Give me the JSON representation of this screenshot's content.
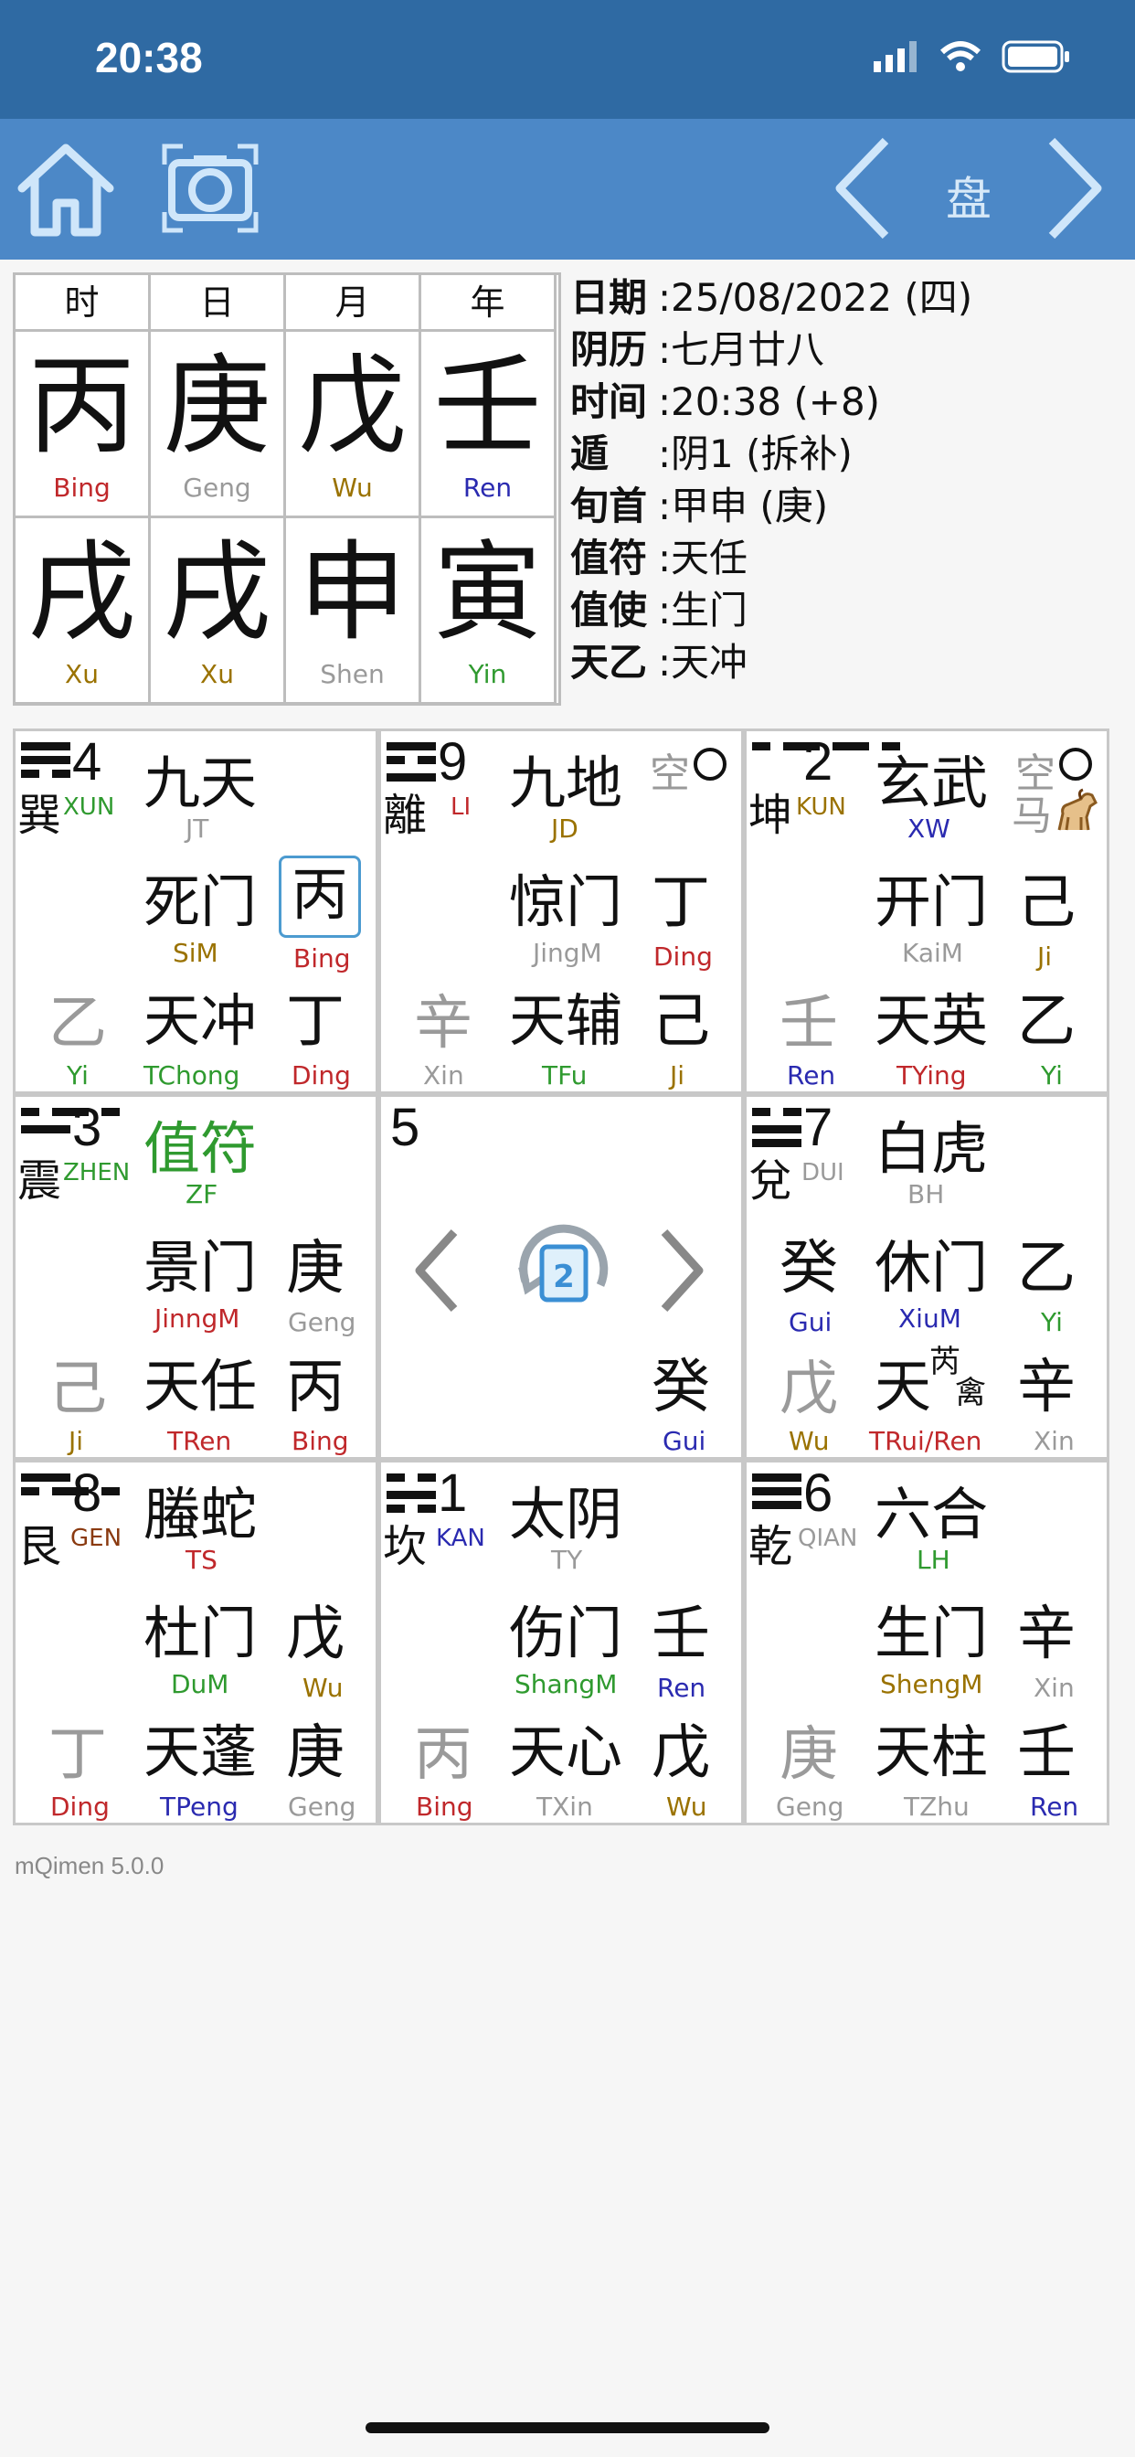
{
  "status_bar": {
    "time": "20:38"
  },
  "toolbar": {
    "center_label": "盘"
  },
  "pillars": [
    {
      "head": "时",
      "stem": "丙",
      "stem_rom": "Bing",
      "stem_color": "#c0282b",
      "branch": "戌",
      "branch_rom": "Xu",
      "branch_color": "#9a7200"
    },
    {
      "head": "日",
      "stem": "庚",
      "stem_rom": "Geng",
      "stem_color": "#9a9a9a",
      "branch": "戌",
      "branch_rom": "Xu",
      "branch_color": "#9a7200"
    },
    {
      "head": "月",
      "stem": "戊",
      "stem_rom": "Wu",
      "stem_color": "#9a7200",
      "branch": "申",
      "branch_rom": "Shen",
      "branch_color": "#9a9a9a"
    },
    {
      "head": "年",
      "stem": "壬",
      "stem_rom": "Ren",
      "stem_color": "#2a2ab0",
      "branch": "寅",
      "branch_rom": "Yin",
      "branch_color": "#2f9a2f"
    }
  ],
  "info": [
    {
      "label": "日期",
      "value": "25/08/2022 (四)"
    },
    {
      "label": "阴历",
      "value": "七月廿八"
    },
    {
      "label": "时间",
      "value": "20:38 (+8)"
    },
    {
      "label": "遁",
      "value": "阴1 (拆补)"
    },
    {
      "label": "旬首",
      "value": "甲申 (庚)"
    },
    {
      "label": "值符",
      "value": "天任"
    },
    {
      "label": "值使",
      "value": "生门"
    },
    {
      "label": "天乙",
      "value": "天冲"
    }
  ],
  "palaces": {
    "xun": {
      "num": "4",
      "tri": "巽",
      "tri_rom": "XUN",
      "deity": "九天",
      "deity_abbr": "JT",
      "door": "死门",
      "door_abbr": "SiM",
      "heaven_stem_upper": "丙",
      "heaven_stem_upper_rom": "Bing",
      "earth_left": "乙",
      "earth_left_rom": "Yi",
      "star": "天冲",
      "star_abbr": "TChong",
      "stem_right": "丁",
      "stem_right_rom": "Ding"
    },
    "li": {
      "num": "9",
      "tri": "離",
      "tri_rom": "LI",
      "empty": "空",
      "deity": "九地",
      "deity_abbr": "JD",
      "door": "惊门",
      "door_abbr": "JingM",
      "upper_right": "丁",
      "upper_right_rom": "Ding",
      "earth_left": "辛",
      "earth_left_rom": "Xin",
      "star": "天辅",
      "star_abbr": "TFu",
      "stem_right": "己",
      "stem_right_rom": "Ji"
    },
    "kun": {
      "num": "2",
      "tri": "坤",
      "tri_rom": "KUN",
      "empty": "空",
      "horse": "马",
      "deity": "玄武",
      "deity_abbr": "XW",
      "door": "开门",
      "door_abbr": "KaiM",
      "upper_right": "己",
      "upper_right_rom": "Ji",
      "earth_left": "壬",
      "earth_left_rom": "Ren",
      "star": "天英",
      "star_abbr": "TYing",
      "stem_right": "乙",
      "stem_right_rom": "Yi"
    },
    "zhen": {
      "num": "3",
      "tri": "震",
      "tri_rom": "ZHEN",
      "deity": "值符",
      "deity_abbr": "ZF",
      "door": "景门",
      "door_abbr": "JinngM",
      "upper_right": "庚",
      "upper_right_rom": "Geng",
      "earth_left": "己",
      "earth_left_rom": "Ji",
      "star": "天任",
      "star_abbr": "TRen",
      "stem_right": "丙",
      "stem_right_rom": "Bing"
    },
    "center": {
      "num": "5",
      "badge": "2",
      "stem": "癸",
      "stem_rom": "Gui"
    },
    "dui": {
      "num": "7",
      "tri": "兌",
      "tri_rom": "DUI",
      "deity": "白虎",
      "deity_abbr": "BH",
      "upper_left": "癸",
      "upper_left_rom": "Gui",
      "door": "休门",
      "door_abbr": "XiuM",
      "upper_right": "乙",
      "upper_right_rom": "Yi",
      "earth_left": "戊",
      "earth_left_rom": "Wu",
      "star": "天",
      "star_sup": "芮",
      "star_sub": "禽",
      "star_abbr": "TRui/Ren",
      "stem_right": "辛",
      "stem_right_rom": "Xin"
    },
    "gen": {
      "num": "8",
      "tri": "艮",
      "tri_rom": "GEN",
      "deity": "螣蛇",
      "deity_abbr": "TS",
      "door": "杜门",
      "door_abbr": "DuM",
      "upper_right": "戊",
      "upper_right_rom": "Wu",
      "earth_left": "丁",
      "earth_left_rom": "Ding",
      "star": "天蓬",
      "star_abbr": "TPeng",
      "stem_right": "庚",
      "stem_right_rom": "Geng"
    },
    "kan": {
      "num": "1",
      "tri": "坎",
      "tri_rom": "KAN",
      "deity": "太阴",
      "deity_abbr": "TY",
      "door": "伤门",
      "door_abbr": "ShangM",
      "upper_right": "壬",
      "upper_right_rom": "Ren",
      "earth_left": "丙",
      "earth_left_rom": "Bing",
      "star": "天心",
      "star_abbr": "TXin",
      "stem_right": "戊",
      "stem_right_rom": "Wu"
    },
    "qian": {
      "num": "6",
      "tri": "乾",
      "tri_rom": "QIAN",
      "deity": "六合",
      "deity_abbr": "LH",
      "door": "生门",
      "door_abbr": "ShengM",
      "upper_right": "辛",
      "upper_right_rom": "Xin",
      "earth_left": "庚",
      "earth_left_rom": "Geng",
      "star": "天柱",
      "star_abbr": "TZhu",
      "stem_right": "壬",
      "stem_right_rom": "Ren"
    }
  },
  "footer": {
    "version": "mQimen 5.0.0"
  },
  "colors": {
    "status_bar": "#2f6aa3",
    "toolbar": "#4c88c7",
    "red": "#c0282b",
    "blue": "#2a2ab0",
    "green": "#2f9a2f",
    "gold": "#9a7200",
    "gray": "#9a9a9a"
  }
}
